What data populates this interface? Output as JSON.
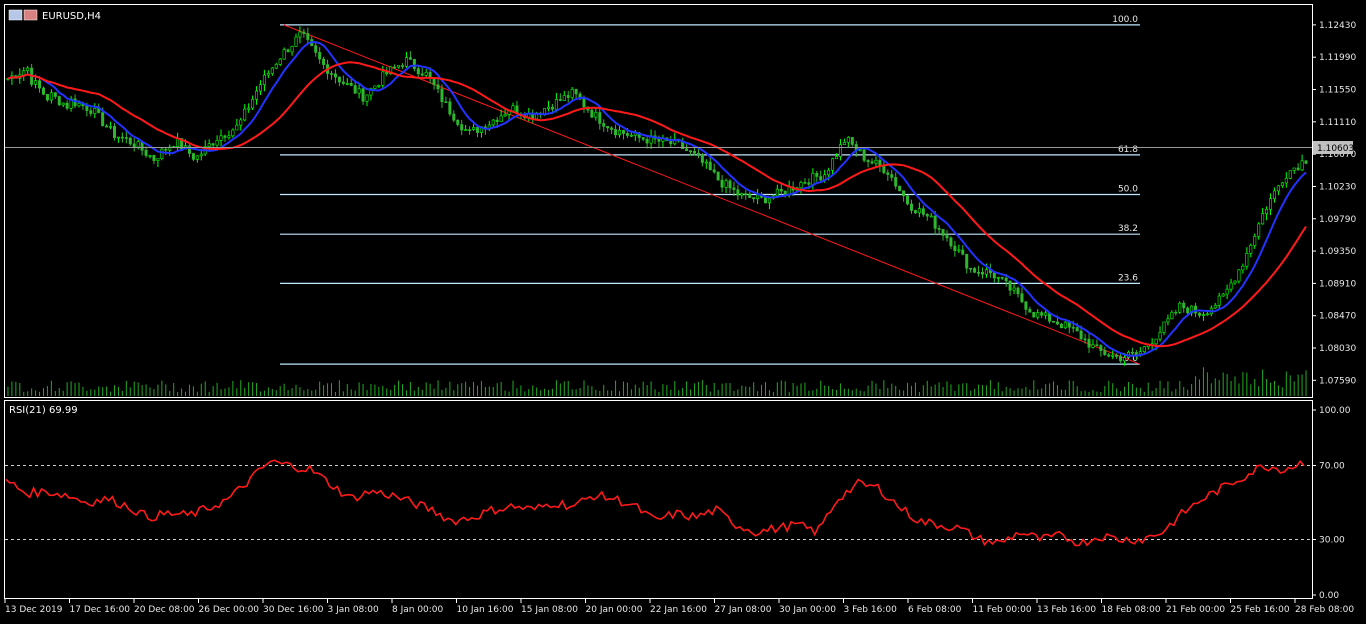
{
  "window": {
    "symbol_label": "EURUSD,H4",
    "current_price": "1.10603",
    "icon": "chart-window-icon"
  },
  "colors": {
    "background": "#000000",
    "bull_candle": "#00ff00",
    "bear_candle": "#2fb82f",
    "fast_ma": "#2233ff",
    "slow_ma": "#ff1a1a",
    "fibo": "#bfe8ff",
    "trendline": "#ff1a1a",
    "volume": "#22aa22",
    "rsi": "#ff1a1a",
    "grid_text": "#e8e8e8",
    "axis_line": "#ffffff",
    "price_badge_bg": "#c0c0c0"
  },
  "chart_data": [
    {
      "type": "candlestick",
      "title": "EURUSD,H4",
      "price_axis": {
        "ticks": [
          "1.12430",
          "1.11990",
          "1.11550",
          "1.11110",
          "1.10670",
          "1.10230",
          "1.09790",
          "1.09350",
          "1.08910",
          "1.08470",
          "1.08030",
          "1.07590"
        ],
        "range": [
          1.0739,
          1.1266
        ]
      },
      "time_axis": {
        "ticks": [
          "13 Dec 2019",
          "17 Dec 16:00",
          "20 Dec 08:00",
          "26 Dec 00:00",
          "30 Dec 16:00",
          "3 Jan 08:00",
          "8 Jan 00:00",
          "10 Jan 16:00",
          "15 Jan 08:00",
          "20 Jan 00:00",
          "22 Jan 16:00",
          "27 Jan 08:00",
          "30 Jan 00:00",
          "3 Feb 16:00",
          "6 Feb 08:00",
          "11 Feb 00:00",
          "13 Feb 16:00",
          "18 Feb 08:00",
          "21 Feb 00:00",
          "25 Feb 16:00",
          "28 Feb 08:00"
        ]
      },
      "price_path_points": [
        [
          1.117,
          1.1185
        ],
        [
          1.1172,
          1.114
        ],
        [
          1.1148,
          1.113
        ],
        [
          1.114,
          1.1128
        ],
        [
          1.1128,
          1.1095
        ],
        [
          1.1095,
          1.1082
        ],
        [
          1.1082,
          1.106
        ],
        [
          1.1062,
          1.1085
        ],
        [
          1.1085,
          1.106
        ],
        [
          1.1062,
          1.109
        ],
        [
          1.109,
          1.1105
        ],
        [
          1.1105,
          1.116
        ],
        [
          1.116,
          1.12
        ],
        [
          1.12,
          1.123
        ],
        [
          1.123,
          1.119
        ],
        [
          1.119,
          1.1165
        ],
        [
          1.1165,
          1.1145
        ],
        [
          1.1145,
          1.1175
        ],
        [
          1.1175,
          1.1195
        ],
        [
          1.1195,
          1.1175
        ],
        [
          1.1175,
          1.113
        ],
        [
          1.113,
          1.1095
        ],
        [
          1.1095,
          1.111
        ],
        [
          1.111,
          1.113
        ],
        [
          1.113,
          1.112
        ],
        [
          1.112,
          1.1135
        ],
        [
          1.1135,
          1.115
        ],
        [
          1.115,
          1.112
        ],
        [
          1.112,
          1.11
        ],
        [
          1.11,
          1.109
        ],
        [
          1.109,
          1.1085
        ],
        [
          1.1085,
          1.108
        ],
        [
          1.108,
          1.106
        ],
        [
          1.106,
          1.103
        ],
        [
          1.103,
          1.101
        ],
        [
          1.101,
          1.1005
        ],
        [
          1.1005,
          1.1015
        ],
        [
          1.1015,
          1.103
        ],
        [
          1.103,
          1.104
        ],
        [
          1.104,
          1.1088
        ],
        [
          1.1088,
          1.106
        ],
        [
          1.106,
          1.1045
        ],
        [
          1.1045,
          1.1
        ],
        [
          1.1,
          1.098
        ],
        [
          1.098,
          1.095
        ],
        [
          1.095,
          1.091
        ],
        [
          1.091,
          1.0905
        ],
        [
          1.0905,
          1.088
        ],
        [
          1.088,
          1.085
        ],
        [
          1.085,
          1.084
        ],
        [
          1.084,
          1.0825
        ],
        [
          1.0825,
          1.08
        ],
        [
          1.08,
          1.079
        ],
        [
          1.079,
          1.0795
        ],
        [
          1.0795,
          1.0825
        ],
        [
          1.0825,
          1.086
        ],
        [
          1.086,
          1.085
        ],
        [
          1.085,
          1.087
        ],
        [
          1.087,
          1.092
        ],
        [
          1.092,
          1.099
        ],
        [
          1.099,
          1.104
        ],
        [
          1.104,
          1.106
        ]
      ],
      "fast_ma_label": "",
      "slow_ma_label": "",
      "fibonacci": {
        "levels": [
          {
            "label": "100.0",
            "price": 1.1243
          },
          {
            "label": "61.8",
            "price": 1.1066
          },
          {
            "label": "50.0",
            "price": 1.1012
          },
          {
            "label": "38.2",
            "price": 1.0958
          },
          {
            "label": "23.6",
            "price": 1.0891
          },
          {
            "label": "0.0",
            "price": 1.0781
          }
        ]
      },
      "trendline": {
        "from": [
          1.1243
        ],
        "to": [
          1.0781
        ]
      }
    },
    {
      "type": "line",
      "title": "RSI(21) 69.99",
      "indicator_label": "RSI(21) 69.99",
      "y_ticks": [
        "100.00",
        "70.00",
        "30.00",
        "0.00"
      ],
      "ylim": [
        0,
        100
      ],
      "levels": [
        70,
        30
      ],
      "rsi_points": [
        62,
        55,
        56,
        54,
        50,
        52,
        48,
        42,
        44,
        43,
        47,
        52,
        62,
        72,
        70,
        68,
        60,
        52,
        56,
        54,
        50,
        46,
        40,
        42,
        46,
        48,
        46,
        50,
        48,
        54,
        52,
        48,
        40,
        44,
        42,
        46,
        38,
        34,
        36,
        38,
        34,
        52,
        60,
        58,
        48,
        40,
        38,
        36,
        30,
        28,
        34,
        30,
        32,
        28,
        32,
        30,
        30,
        34,
        44,
        52,
        58,
        64,
        70,
        68,
        72
      ]
    }
  ]
}
